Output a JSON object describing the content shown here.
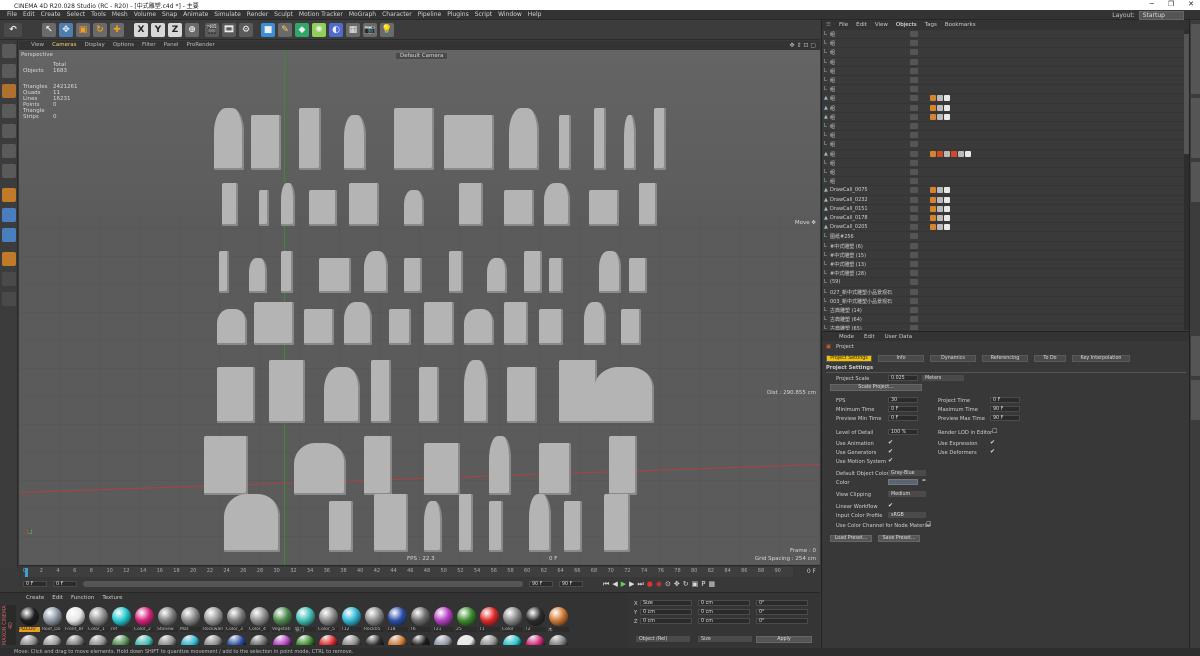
{
  "titlebar": {
    "title": "CINEMA 4D R20.028 Studio (RC - R20) - [中式雕塑.c4d *] - 主要"
  },
  "menubar": {
    "items": [
      "File",
      "Edit",
      "Create",
      "Select",
      "Tools",
      "Mesh",
      "Volume",
      "Snap",
      "Animate",
      "Simulate",
      "Render",
      "Sculpt",
      "Motion Tracker",
      "MoGraph",
      "Character",
      "Pipeline",
      "Plugins",
      "Script",
      "Window",
      "Help"
    ],
    "layout_label": "Layout:",
    "layout_value": "Startup"
  },
  "toolbar": {
    "axis": [
      "X",
      "Y",
      "Z"
    ]
  },
  "viewport": {
    "menu": [
      "View",
      "Cameras",
      "Display",
      "Options",
      "Filter",
      "Panel",
      "ProRender"
    ],
    "label": "Perspective",
    "camera": "Default Camera",
    "move_hint": "Move ✥",
    "stats": {
      "total_label": "Total",
      "objects_label": "Objects",
      "objects": "1683",
      "triangles_label": "Triangles",
      "triangles": "2421261",
      "quads_label": "Quads",
      "quads": "11",
      "lines_label": "Lines",
      "lines": "16231",
      "points_label": "Points",
      "points": "0",
      "strips_label": "Triangle Strips",
      "strips": "0"
    },
    "dist": "Dist : 290.855 cm",
    "fps": "FPS : 22.3",
    "frame": "Frame : 0",
    "grid": "Grid Spacing : 254 cm",
    "axis_label": "0 F"
  },
  "timeline": {
    "ticks": [
      "0",
      "2",
      "4",
      "6",
      "8",
      "10",
      "12",
      "14",
      "16",
      "18",
      "20",
      "22",
      "24",
      "26",
      "28",
      "30",
      "32",
      "34",
      "36",
      "38",
      "40",
      "42",
      "44",
      "46",
      "48",
      "50",
      "52",
      "54",
      "56",
      "58",
      "60",
      "62",
      "64",
      "66",
      "68",
      "70",
      "72",
      "74",
      "76",
      "78",
      "80",
      "82",
      "84",
      "86",
      "88",
      "90"
    ],
    "start": "0 F",
    "cur": "0 F",
    "end": "90 F",
    "end2": "90 F",
    "frame_right": "0 F"
  },
  "materials": {
    "menu": [
      "Create",
      "Edit",
      "Function",
      "Texture"
    ],
    "items": [
      {
        "label": "PIZEDU",
        "color": "#1d1d1d"
      },
      {
        "label": "Roof_Do",
        "color": "#8c97a3"
      },
      {
        "label": "Front_Br",
        "color": "#e6e6e6"
      },
      {
        "label": "Color_1",
        "color": "#8f8f8f"
      },
      {
        "label": "ref",
        "color": "#23c7cf"
      },
      {
        "label": "Color_2",
        "color": "#d4227a"
      },
      {
        "label": "Stonew",
        "color": "#7d7d7d"
      },
      {
        "label": "Mat",
        "color": "#8a8a8a"
      },
      {
        "label": "Rockwall",
        "color": "#9a9a9a"
      },
      {
        "label": "Color_3",
        "color": "#7a7a7a"
      },
      {
        "label": "Color_4",
        "color": "#8e8e8e"
      },
      {
        "label": "Vegetati",
        "color": "#4e8a4e"
      },
      {
        "label": "铁门",
        "color": "#3fbcb4"
      },
      {
        "label": "Color_5",
        "color": "#8c8c8c"
      },
      {
        "label": "T12",
        "color": "#2fb7d2"
      },
      {
        "label": "Rock05",
        "color": "#8b8b8b"
      },
      {
        "label": "T18",
        "color": "#2a4ea8"
      },
      {
        "label": "T6",
        "color": "#6c6c6c"
      },
      {
        "label": "T21",
        "color": "#b63fc4"
      },
      {
        "label": "25",
        "color": "#3b8c2c"
      },
      {
        "label": "T1",
        "color": "#e02828"
      },
      {
        "label": "Color",
        "color": "#8a8a8a"
      },
      {
        "label": "T2",
        "color": "#2b2b2b"
      },
      {
        "label": "木",
        "color": "#d07832"
      }
    ]
  },
  "coords": {
    "rows": [
      [
        "Size",
        "0 cm",
        "P",
        "0°"
      ],
      [
        "0 cm",
        "Y",
        "0 cm",
        "0°"
      ],
      [
        "0 cm",
        "Z",
        "0 cm",
        "B",
        "0°"
      ]
    ],
    "mode": "Object (Rel)",
    "size_mode": "Size",
    "apply": "Apply"
  },
  "objmgr": {
    "menu": [
      "File",
      "Edit",
      "View",
      "Objects",
      "Tags",
      "Bookmarks"
    ],
    "rows": [
      {
        "name": "组",
        "tags": []
      },
      {
        "name": "组",
        "tags": []
      },
      {
        "name": "组",
        "tags": []
      },
      {
        "name": "组",
        "tags": []
      },
      {
        "name": "组",
        "tags": []
      },
      {
        "name": "组",
        "tags": []
      },
      {
        "name": "组",
        "tags": []
      },
      {
        "name": "组",
        "tags": [
          "#d7842c",
          "#bbbbbb",
          "#e8e8e8"
        ]
      },
      {
        "name": "组",
        "tags": [
          "#d7842c",
          "#bbbbbb",
          "#e8e8e8"
        ]
      },
      {
        "name": "组",
        "tags": [
          "#d7842c",
          "#bbbbbb",
          "#e8e8e8"
        ]
      },
      {
        "name": "组",
        "tags": []
      },
      {
        "name": "组",
        "tags": []
      },
      {
        "name": "组",
        "tags": []
      },
      {
        "name": "组",
        "tags": [
          "#d7842c",
          "#d04a2a",
          "#bbbbbb",
          "#d04a2a",
          "#bbbbbb",
          "#e8e8e8"
        ]
      },
      {
        "name": "组",
        "tags": []
      },
      {
        "name": "组",
        "tags": []
      },
      {
        "name": "组",
        "tags": []
      },
      {
        "name": "DrawCall_0075",
        "tags": [
          "#d7842c",
          "#bbbbbb",
          "#e8e8e8"
        ]
      },
      {
        "name": "DrawCall_0232",
        "tags": [
          "#d7842c",
          "#bbbbbb",
          "#e8e8e8"
        ]
      },
      {
        "name": "DrawCall_0151",
        "tags": [
          "#d7842c",
          "#bbbbbb",
          "#e8e8e8"
        ]
      },
      {
        "name": "DrawCall_0178",
        "tags": [
          "#d7842c",
          "#bbbbbb",
          "#e8e8e8"
        ]
      },
      {
        "name": "DrawCall_0205",
        "tags": [
          "#d7842c",
          "#bbbbbb",
          "#e8e8e8"
        ]
      },
      {
        "name": "图纸#256",
        "tags": []
      },
      {
        "name": "#中式雕塑 (6)",
        "tags": []
      },
      {
        "name": "#中式雕塑 (15)",
        "tags": []
      },
      {
        "name": "#中式雕塑 (13)",
        "tags": []
      },
      {
        "name": "#中式雕塑 (28)",
        "tags": []
      },
      {
        "name": "(59)",
        "tags": []
      },
      {
        "name": "027_新中式雕塑小品景观石",
        "tags": []
      },
      {
        "name": "003_新中式雕塑小品景观石",
        "tags": []
      },
      {
        "name": "古典雕塑 (14)",
        "tags": []
      },
      {
        "name": "古典雕塑 (64)",
        "tags": []
      },
      {
        "name": "古典雕塑 (65)",
        "tags": []
      }
    ]
  },
  "attr": {
    "menu": [
      "Mode",
      "Edit",
      "User Data"
    ],
    "title": "Project",
    "tabs": [
      "Project Settings",
      "Info",
      "Dynamics",
      "Referencing",
      "To Do",
      "Key Interpolation"
    ],
    "section": "Project Settings",
    "project_scale_label": "Project Scale",
    "project_scale": "0.025",
    "project_unit": "Meters",
    "scale_project": "Scale Project...",
    "fps_label": "FPS",
    "fps": "30",
    "project_time_label": "Project Time",
    "project_time": "0 F",
    "min_time_label": "Minimum Time",
    "min_time": "0 F",
    "max_time_label": "Maximum Time",
    "max_time": "90 F",
    "prev_min_label": "Preview Min Time",
    "prev_min": "0 F",
    "prev_max_label": "Preview Max Time",
    "prev_max": "90 F",
    "lod_label": "Level of Detail",
    "lod": "100 %",
    "render_lod_label": "Render LOD in Editor",
    "use_anim": "Use Animation",
    "use_expr": "Use Expression",
    "use_gen": "Use Generators",
    "use_def": "Use Deformers",
    "use_motion": "Use Motion System",
    "default_color_label": "Default Object Color",
    "default_color": "Gray-Blue",
    "color_label": "Color",
    "view_clip_label": "View Clipping",
    "view_clip": "Medium",
    "linear_label": "Linear Workflow",
    "input_profile_label": "Input Color Profile",
    "input_profile": "sRGB",
    "color_channel_label": "Use Color Channel for Node Material",
    "load_preset": "Load Preset...",
    "save_preset": "Save Preset..."
  },
  "statusbar": {
    "text": "Move: Click and drag to move elements. Hold down SHIFT to quantize movement / add to the selection in point mode, CTRL to remove."
  },
  "colors": {
    "accent": "#ffb300",
    "selected_tab": "#f2c200"
  }
}
